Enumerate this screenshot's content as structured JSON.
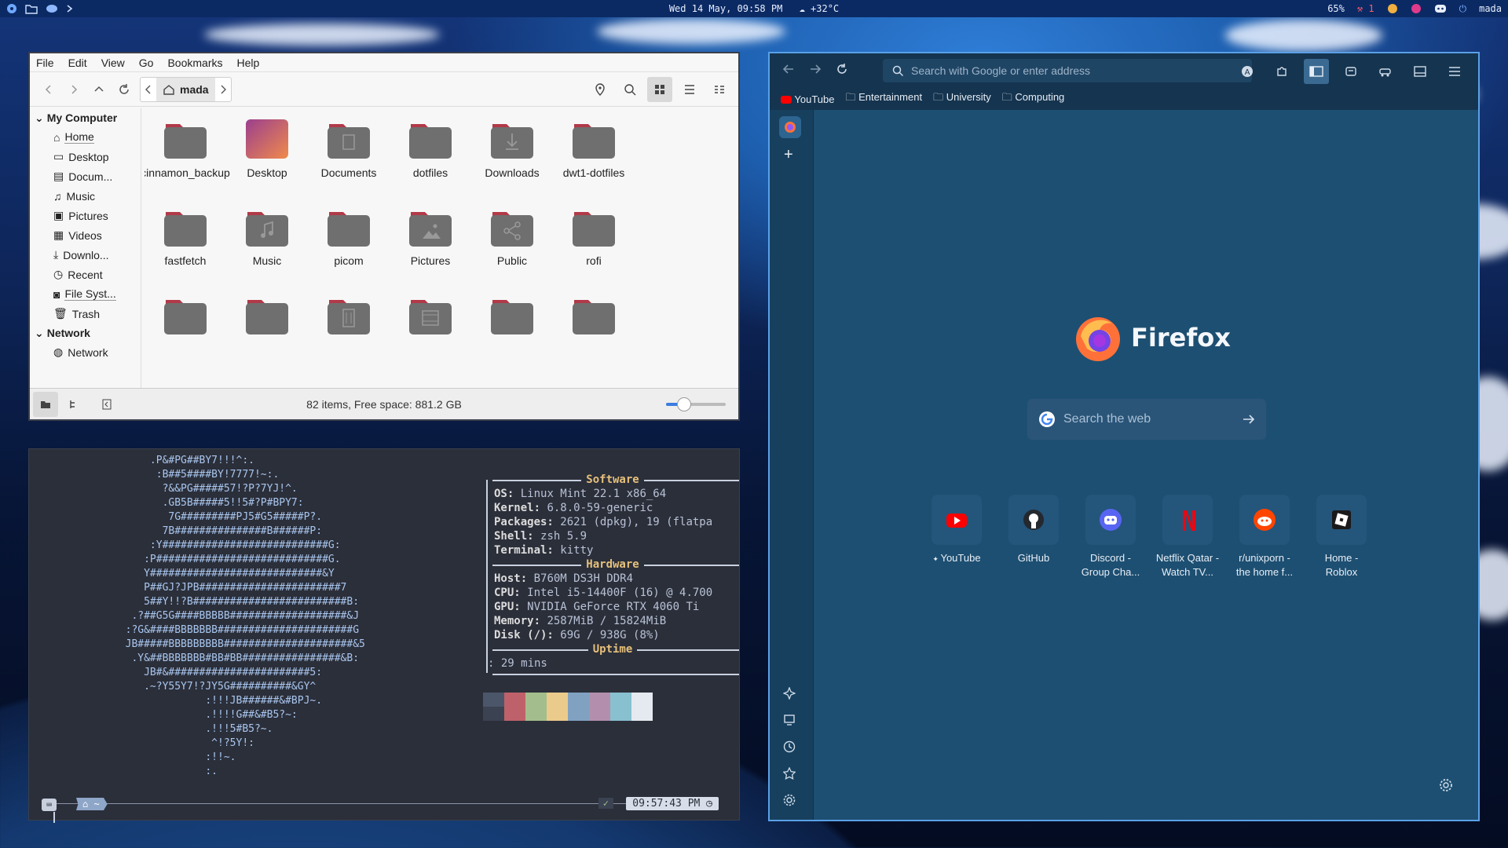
{
  "topbar": {
    "datetime": "Wed 14 May, 09:58 PM",
    "weather": "+32°C",
    "battery": "65%",
    "updates": "1",
    "user": "mada"
  },
  "files": {
    "menu": [
      "File",
      "Edit",
      "View",
      "Go",
      "Bookmarks",
      "Help"
    ],
    "path": "mada",
    "sidebar": {
      "my_computer": "My Computer",
      "items": [
        "Home",
        "Desktop",
        "Docum...",
        "Music",
        "Pictures",
        "Videos",
        "Downlo...",
        "Recent",
        "File Syst...",
        "Trash"
      ],
      "network_head": "Network",
      "network_items": [
        "Network"
      ]
    },
    "items": [
      "cinnamon_backup",
      "Desktop",
      "Documents",
      "dotfiles",
      "Downloads",
      "dwt1-dotfiles",
      "fastfetch",
      "Music",
      "picom",
      "Pictures",
      "Public",
      "rofi"
    ],
    "status": "82 items, Free space: 881.2 GB",
    "zoom": 0.3
  },
  "terminal": {
    "ascii": [
      "            .P&#PG##BY7!!!^:.",
      "             :B##5####BY!7777!~:.",
      "              ?&&PG#####57!?P?7YJ!^.",
      "              .GB5B#####5!!5#?P#BPY7:",
      "               7G#########PJ5#G5#####P?.",
      "              7B###############B######P:",
      "            :Y###########################G:",
      "           :P############################G.",
      "           Y############################&Y",
      "           P##GJ?JPB#######################7",
      "           5##Y!!?B#########################B:",
      "         .?##G5G####BBBBB###################&J",
      "        :?G&####BBBBBBB######################G",
      "        JB#####BBBBBBBBB#####################&5",
      "         .Y&##BBBBBBB#BB#BB################&B:",
      "           JB#&#######################5:",
      "           .~?Y55Y7!?JY5G##########&GY^",
      "                     :!!!JB######&#BPJ~.",
      "                     .!!!!G##&#B5?~:",
      "                     .!!!5#B5?~.",
      "                      ^!?5Y!:",
      "                     :!!~.",
      "                     :."
    ],
    "sections": {
      "software": "Software",
      "hardware": "Hardware",
      "uptime": "Uptime"
    },
    "software": [
      [
        "OS:",
        "Linux Mint 22.1 x86_64"
      ],
      [
        "Kernel:",
        "6.8.0-59-generic"
      ],
      [
        "Packages:",
        "2621 (dpkg), 19 (flatpa"
      ],
      [
        "Shell:",
        "zsh 5.9"
      ],
      [
        "Terminal:",
        "kitty"
      ]
    ],
    "hardware": [
      [
        "Host:",
        "B760M DS3H DDR4"
      ],
      [
        "CPU:",
        "Intel i5-14400F (16) @ 4.700"
      ],
      [
        "GPU:",
        "NVIDIA GeForce RTX 4060 Ti"
      ],
      [
        "Memory:",
        "2587MiB / 15824MiB"
      ],
      [
        "Disk (/):",
        "69G / 938G (8%)"
      ]
    ],
    "uptime": ": 29 mins",
    "prompt_dir": "~",
    "prompt_time": "09:57:43 PM",
    "check": "✓",
    "palette": [
      "#3b4252",
      "#bf616a",
      "#a3be8c",
      "#ebcb8b",
      "#81a1c1",
      "#b48ead",
      "#88c0d0",
      "#e5e9f0"
    ]
  },
  "firefox": {
    "url_placeholder": "Search with Google or enter address",
    "bookmarks": [
      "YouTube",
      "Entertainment",
      "University",
      "Computing"
    ],
    "brand": "Firefox",
    "search_placeholder": "Search the web",
    "shortcuts": [
      {
        "l1": "YouTube",
        "l2": ""
      },
      {
        "l1": "GitHub",
        "l2": ""
      },
      {
        "l1": "Discord -",
        "l2": "Group Cha..."
      },
      {
        "l1": "Netflix Qatar -",
        "l2": "Watch TV..."
      },
      {
        "l1": "r/unixporn -",
        "l2": "the home f..."
      },
      {
        "l1": "Home -",
        "l2": "Roblox"
      }
    ]
  }
}
